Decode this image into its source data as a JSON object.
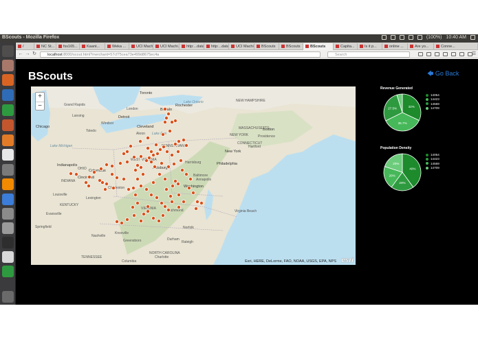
{
  "top_panel": {
    "window_title": "BScouts - Mozilla Firefox",
    "battery": "(100%)",
    "clock": "10:40 AM"
  },
  "launcher": {
    "items": [
      {
        "icon": "dash-icon",
        "color": "#4f4e4c"
      },
      {
        "icon": "files-icon",
        "color": "#a8786a"
      },
      {
        "icon": "firefox-icon",
        "color": "#d86424"
      },
      {
        "icon": "writer-icon",
        "color": "#2f6cb7"
      },
      {
        "icon": "calc-icon",
        "color": "#2e9a3f"
      },
      {
        "icon": "impress-icon",
        "color": "#c4562d"
      },
      {
        "icon": "software-center-icon",
        "color": "#e27b28"
      },
      {
        "icon": "amazon-icon",
        "color": "#e8e8e8"
      },
      {
        "icon": "settings-icon",
        "color": "#7a7a7a"
      },
      {
        "icon": "vlc-icon",
        "color": "#f08a00"
      },
      {
        "icon": "chromium-icon",
        "color": "#3b7dd8"
      },
      {
        "icon": "disk-icon",
        "color": "#8b8b8b"
      },
      {
        "icon": "drive-icon",
        "color": "#9a9a9a"
      },
      {
        "icon": "terminal-icon",
        "color": "#2e2e2e"
      },
      {
        "icon": "text-editor-icon",
        "color": "#d8d8d8"
      },
      {
        "icon": "update-icon",
        "color": "#2e9a3f"
      },
      {
        "icon": "trash-icon",
        "color": "#6a6a6a"
      }
    ]
  },
  "tabs": [
    {
      "label": "/"
    },
    {
      "label": "NC St..."
    },
    {
      "label": "fss165..."
    },
    {
      "label": "Kaant..."
    },
    {
      "label": "Weka ..."
    },
    {
      "label": "UCI Machi..."
    },
    {
      "label": "UCI Machi..."
    },
    {
      "label": "http:...data"
    },
    {
      "label": "http:...data"
    },
    {
      "label": "UCI Machi..."
    },
    {
      "label": "BScouts"
    },
    {
      "label": "BScouts"
    },
    {
      "label": "BScouts",
      "active": true
    },
    {
      "label": "Capita..."
    },
    {
      "label": "Is it p..."
    },
    {
      "label": "online ..."
    },
    {
      "label": "Are yo..."
    },
    {
      "label": "Conne..."
    }
  ],
  "navbar": {
    "url_host": "localhost",
    "url_rest": ":8000/scout.html?merchant=57cf75cea73e499d8675ec4a",
    "search_placeholder": "Search"
  },
  "page": {
    "title": "BScouts",
    "back_label": "Go Back",
    "accent": "#2a7ad8"
  },
  "map": {
    "zoom_in": "+",
    "zoom_out": "−",
    "attribution": "Esri, HERE, DeLorme, FAO, NOAA, USGS, EPA, NPS",
    "logo": "esri",
    "marker_color": "#d8521c",
    "labels": [
      {
        "text": "Toronto",
        "kind": "big"
      },
      {
        "text": "Rochester",
        "kind": "big"
      },
      {
        "text": "Buffalo",
        "kind": "big"
      },
      {
        "text": "London",
        "kind": ""
      },
      {
        "text": "Grand Rapids",
        "kind": ""
      },
      {
        "text": "Lansing",
        "kind": ""
      },
      {
        "text": "Detroit",
        "kind": "big"
      },
      {
        "text": "Windsor",
        "kind": ""
      },
      {
        "text": "Chicago",
        "kind": "big"
      },
      {
        "text": "Toledo",
        "kind": ""
      },
      {
        "text": "Cleveland",
        "kind": "big"
      },
      {
        "text": "Akron",
        "kind": ""
      },
      {
        "text": "Lake Erie",
        "kind": "water"
      },
      {
        "text": "Lake Ontario",
        "kind": "water"
      },
      {
        "text": "Lake Michigan",
        "kind": "water"
      },
      {
        "text": "NEW HAMPSHIRE",
        "kind": ""
      },
      {
        "text": "MASSACHUSETTS",
        "kind": ""
      },
      {
        "text": "Boston",
        "kind": "big"
      },
      {
        "text": "Providence",
        "kind": ""
      },
      {
        "text": "CONNECTICUT",
        "kind": ""
      },
      {
        "text": "NEW YORK",
        "kind": ""
      },
      {
        "text": "New York",
        "kind": "big"
      },
      {
        "text": "Philadelphia",
        "kind": "big"
      },
      {
        "text": "Harrisburg",
        "kind": ""
      },
      {
        "text": "Pittsburgh",
        "kind": "big"
      },
      {
        "text": "PENNSYLVANIA",
        "kind": ""
      },
      {
        "text": "Columbus",
        "kind": "big"
      },
      {
        "text": "OHIO",
        "kind": ""
      },
      {
        "text": "Indianapolis",
        "kind": "big"
      },
      {
        "text": "INDIANA",
        "kind": ""
      },
      {
        "text": "Cincinnati",
        "kind": "big"
      },
      {
        "text": "Baltimore",
        "kind": ""
      },
      {
        "text": "Annapolis",
        "kind": ""
      },
      {
        "text": "Washington",
        "kind": "big"
      },
      {
        "text": "Virginia Beach",
        "kind": ""
      },
      {
        "text": "WEST VIRGINIA",
        "kind": ""
      },
      {
        "text": "Charleston",
        "kind": ""
      },
      {
        "text": "Louisville",
        "kind": ""
      },
      {
        "text": "Lexington",
        "kind": ""
      },
      {
        "text": "KENTUCKY",
        "kind": ""
      },
      {
        "text": "VIRGINIA",
        "kind": ""
      },
      {
        "text": "Richmond",
        "kind": ""
      },
      {
        "text": "Norfolk",
        "kind": ""
      },
      {
        "text": "Nashville",
        "kind": ""
      },
      {
        "text": "Knoxville",
        "kind": ""
      },
      {
        "text": "Greensboro",
        "kind": ""
      },
      {
        "text": "Durham",
        "kind": ""
      },
      {
        "text": "Raleigh",
        "kind": ""
      },
      {
        "text": "NORTH CAROLINA",
        "kind": ""
      },
      {
        "text": "Charlotte",
        "kind": ""
      },
      {
        "text": "TENNESSEE",
        "kind": ""
      },
      {
        "text": "Columbia",
        "kind": ""
      },
      {
        "text": "Evansville",
        "kind": ""
      },
      {
        "text": "Springfield",
        "kind": ""
      },
      {
        "text": "Hartford",
        "kind": ""
      }
    ]
  },
  "charts": [
    {
      "title": "Revenue Generated",
      "chart_data": {
        "type": "pie",
        "categories": [
          "14054",
          "14423",
          "14569",
          "14709"
        ],
        "values": [
          32,
          35.7,
          27.5,
          4.8
        ],
        "slice_labels": [
          "32%",
          "35.7%",
          "27.5%",
          ""
        ],
        "colors": [
          "#1d8a2c",
          "#46b859",
          "#2e9a3f",
          "#6ccc7c"
        ]
      }
    },
    {
      "title": "Population Density",
      "chart_data": {
        "type": "pie",
        "categories": [
          "14054",
          "14423",
          "14569",
          "14709"
        ],
        "values": [
          40,
          20,
          20,
          20
        ],
        "slice_labels": [
          "40%",
          "20%",
          "20%",
          "20%"
        ],
        "colors": [
          "#1d8a2c",
          "#2e9a3f",
          "#46b859",
          "#6ccc7c"
        ]
      }
    }
  ]
}
